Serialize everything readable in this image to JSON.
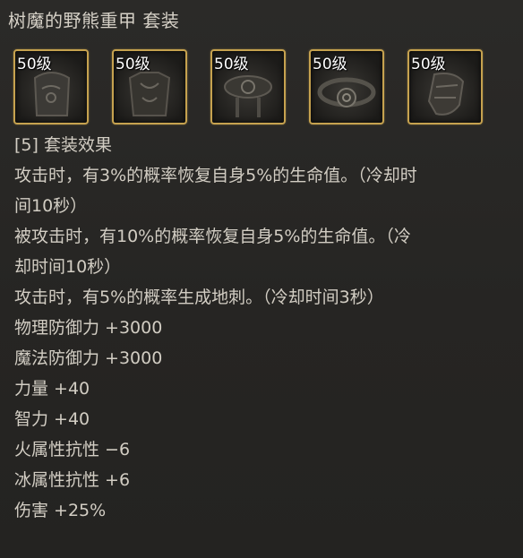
{
  "title": "树魔的野熊重甲  套装",
  "pieces": [
    {
      "level": "50级",
      "icon": "armor-helmet-icon"
    },
    {
      "level": "50级",
      "icon": "armor-chest-icon"
    },
    {
      "level": "50级",
      "icon": "armor-belt-icon"
    },
    {
      "level": "50级",
      "icon": "armor-necklace-icon"
    },
    {
      "level": "50级",
      "icon": "armor-gauntlet-icon"
    }
  ],
  "set_header": "[5] 套装效果",
  "effects": [
    "攻击时，有3%的概率恢复自身5%的生命值。（冷却时",
    "间10秒）",
    "被攻击时，有10%的概率恢复自身5%的生命值。（冷",
    "却时间10秒）",
    "攻击时，有5%的概率生成地刺。（冷却时间3秒）"
  ],
  "stats": [
    "物理防御力 +3000",
    "魔法防御力 +3000",
    "力量 +40",
    "智力 +40",
    "火属性抗性 −6",
    "冰属性抗性 +6",
    "伤害 +25%"
  ],
  "colors": {
    "frame": "#c6a24f",
    "text": "#d2cdc3",
    "background": "#272624"
  }
}
